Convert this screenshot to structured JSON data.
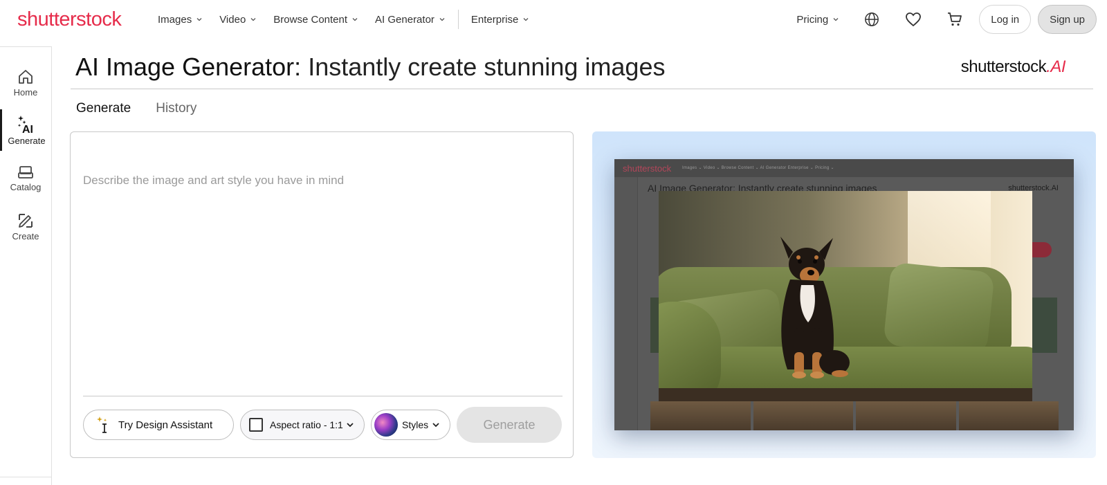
{
  "brand": {
    "logo_text": "shutterstock",
    "accent_color": "#e62c4b"
  },
  "topnav": {
    "items": [
      {
        "label": "Images"
      },
      {
        "label": "Video"
      },
      {
        "label": "Browse Content"
      },
      {
        "label": "AI Generator"
      },
      {
        "label": "Enterprise"
      }
    ],
    "pricing_label": "Pricing",
    "icons": [
      "globe-icon",
      "heart-icon",
      "cart-icon"
    ],
    "login_label": "Log in",
    "signup_label": "Sign up"
  },
  "sidebar": {
    "items": [
      {
        "label": "Home",
        "icon": "home-icon"
      },
      {
        "label": "Generate",
        "icon": "ai-sparkle-icon",
        "active": true
      },
      {
        "label": "Catalog",
        "icon": "catalog-icon"
      },
      {
        "label": "Create",
        "icon": "edit-pencil-icon"
      }
    ]
  },
  "header": {
    "title_bold": "AI Image Generator:",
    "title_light": "Instantly create stunning images",
    "ai_logo_text": "shutterstock",
    "ai_logo_suffix": ".AI"
  },
  "tabs": [
    {
      "label": "Generate",
      "active": true
    },
    {
      "label": "History",
      "active": false
    }
  ],
  "prompt": {
    "placeholder": "Describe the image and art style you have in mind",
    "value": "",
    "design_assistant_label": "Try Design Assistant",
    "aspect_ratio_label": "Aspect ratio - 1:1",
    "styles_label": "Styles",
    "generate_label": "Generate"
  },
  "preview": {
    "mock_logo": "shutterstock",
    "mock_nav": "Images ⌄   Video ⌄   Browse Content ⌄   AI Generator   Enterprise ⌄                                                              Pricing ⌄",
    "mock_title": "AI Image Generator: Instantly create stunning images",
    "mock_ai_logo": "shutterstock.AI",
    "image_subject": "dog-on-green-sofa"
  }
}
